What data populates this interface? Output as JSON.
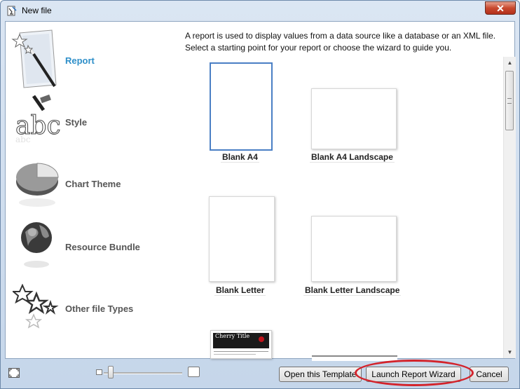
{
  "window": {
    "title": "New file",
    "close_label": "✕"
  },
  "sidebar": {
    "items": [
      {
        "label": "Report",
        "icon": "report-icon",
        "active": true
      },
      {
        "label": "Style",
        "icon": "style-icon",
        "active": false
      },
      {
        "label": "Chart Theme",
        "icon": "chart-theme-icon",
        "active": false
      },
      {
        "label": "Resource Bundle",
        "icon": "resource-bundle-icon",
        "active": false
      },
      {
        "label": "Other file Types",
        "icon": "other-file-types-icon",
        "active": false
      }
    ]
  },
  "main": {
    "description_line1": "A report is used to display values from a data source like a database or an XML file.",
    "description_line2": "Select a starting point for your report or choose the wizard to guide you.",
    "templates": [
      {
        "label": "Blank A4",
        "selected": true
      },
      {
        "label": "Blank A4 Landscape",
        "selected": false
      },
      {
        "label": "Blank Letter",
        "selected": false
      },
      {
        "label": "Blank Letter Landscape",
        "selected": false
      },
      {
        "label": "Cherry Title",
        "selected": false
      }
    ]
  },
  "footer": {
    "open_template_label": "Open this Template",
    "launch_wizard_label": "Launch Report Wizard",
    "cancel_label": "Cancel"
  },
  "colors": {
    "accent": "#2e8fc9",
    "selection_border": "#4a7fc4",
    "annotation_red": "#d3232b"
  }
}
